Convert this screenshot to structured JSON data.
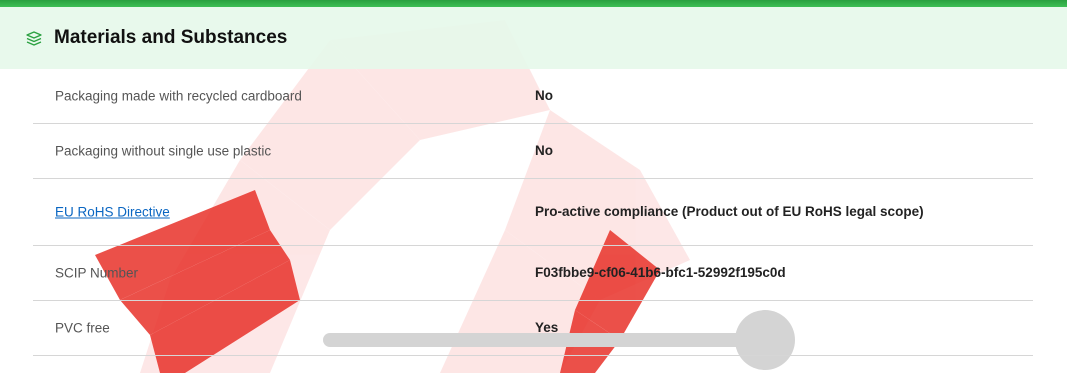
{
  "section": {
    "title": "Materials and Substances",
    "icon": "layers-icon"
  },
  "rows": [
    {
      "label": "Packaging made with recycled cardboard",
      "value": "No",
      "is_link": false
    },
    {
      "label": "Packaging without single use plastic",
      "value": "No",
      "is_link": false
    },
    {
      "label": "EU RoHS Directive",
      "value": "Pro-active compliance (Product out of EU RoHS legal scope)",
      "is_link": true
    },
    {
      "label": "SCIP Number",
      "value": "F03fbbe9-cf06-41b6-bfc1-52992f195c0d",
      "is_link": false
    },
    {
      "label": "PVC free",
      "value": "Yes",
      "is_link": false
    }
  ],
  "colors": {
    "accent": "#3dcd58",
    "header_bg": "#e6f8ea",
    "link": "#0a66c2",
    "watermark": "#e8322a"
  }
}
